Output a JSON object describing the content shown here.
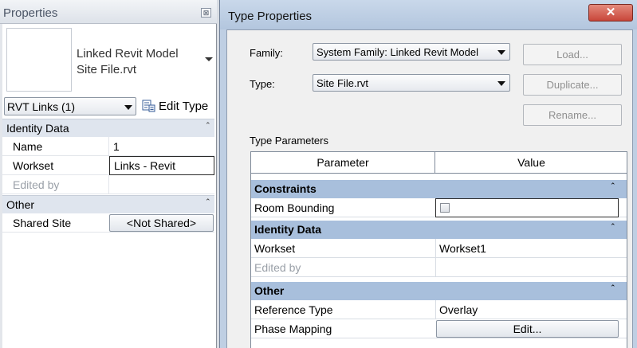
{
  "properties": {
    "title": "Properties",
    "close_glyph": "⊠",
    "type_name_line1": "Linked Revit Model",
    "type_name_line2": "Site File.rvt",
    "selector_value": "RVT Links (1)",
    "edit_type_label": "Edit Type",
    "groups": [
      {
        "name": "Identity Data",
        "caret": "⌃",
        "rows": [
          {
            "key": "Name",
            "value": "1"
          },
          {
            "key": "Workset",
            "value": "Links - Revit"
          },
          {
            "key": "Edited by",
            "value": ""
          }
        ]
      },
      {
        "name": "Other",
        "caret": "⌃",
        "rows": [
          {
            "key": "Shared Site",
            "value": "<Not Shared>"
          }
        ]
      }
    ]
  },
  "type_properties": {
    "title": "Type Properties",
    "close_glyph": "✕",
    "family_label": "Family:",
    "family_value": "System Family: Linked Revit Model",
    "type_label": "Type:",
    "type_value": "Site File.rvt",
    "load_label": "Load...",
    "duplicate_label": "Duplicate...",
    "rename_label": "Rename...",
    "type_parameters_label": "Type Parameters",
    "columns": {
      "parameter": "Parameter",
      "value": "Value"
    },
    "groups": [
      {
        "name": "Constraints",
        "caret": "⌃",
        "rows": [
          {
            "key": "Room Bounding",
            "value": "",
            "checked": false
          }
        ]
      },
      {
        "name": "Identity Data",
        "caret": "⌃",
        "rows": [
          {
            "key": "Workset",
            "value": "Workset1"
          },
          {
            "key": "Edited by",
            "value": ""
          }
        ]
      },
      {
        "name": "Other",
        "caret": "⌃",
        "rows": [
          {
            "key": "Reference Type",
            "value": "Overlay"
          },
          {
            "key": "Phase Mapping",
            "value": "Edit..."
          }
        ]
      }
    ]
  }
}
